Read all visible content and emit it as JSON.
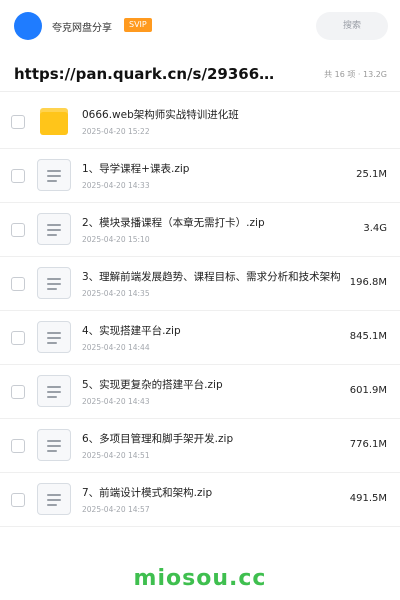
{
  "header": {
    "site_name": "夸克网盘分享",
    "badge": "SVIP",
    "search_label": "搜索"
  },
  "share": {
    "url": "https://pan.quark.cn/s/29366026…",
    "meta": "共 16 项 · 13.2G"
  },
  "files": [
    {
      "type": "folder",
      "name": "0666.web架构师实战特训进化班",
      "date": "2025-04-20 15:22",
      "size": ""
    },
    {
      "type": "zip",
      "name": "1、导学课程+课表.zip",
      "date": "2025-04-20 14:33",
      "size": "25.1M"
    },
    {
      "type": "zip",
      "name": "2、模块录播课程（本章无需打卡）.zip",
      "date": "2025-04-20 15:10",
      "size": "3.4G"
    },
    {
      "type": "zip",
      "name": "3、理解前端发展趋势、课程目标、需求分析和技术架构",
      "date": "2025-04-20 14:35",
      "size": "196.8M"
    },
    {
      "type": "zip",
      "name": "4、实现搭建平台.zip",
      "date": "2025-04-20 14:44",
      "size": "845.1M"
    },
    {
      "type": "zip",
      "name": "5、实现更复杂的搭建平台.zip",
      "date": "2025-04-20 14:43",
      "size": "601.9M"
    },
    {
      "type": "zip",
      "name": "6、多项目管理和脚手架开发.zip",
      "date": "2025-04-20 14:51",
      "size": "776.1M"
    },
    {
      "type": "zip",
      "name": "7、前端设计模式和架构.zip",
      "date": "2025-04-20 14:57",
      "size": "491.5M"
    }
  ],
  "watermark": "miosou.cc",
  "colors": {
    "accent": "#1f7cff",
    "badge": "#ff9a1f",
    "folder": "#ffc51a",
    "watermark": "#3fbf4f"
  }
}
